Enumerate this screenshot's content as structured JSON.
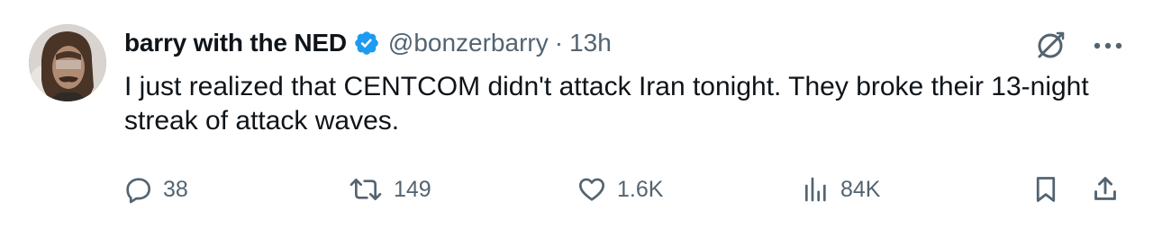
{
  "tweet": {
    "author": {
      "display_name": "barry with the NED",
      "handle": "@bonzerbarry",
      "separator": "·",
      "time": "13h",
      "verified_color": "#1d9bf0"
    },
    "text": "I just realized that CENTCOM didn't attack Iran tonight. They broke their 13-night streak of attack waves.",
    "stats": {
      "replies": "38",
      "reposts": "149",
      "likes": "1.6K",
      "views": "84K"
    },
    "icons": {
      "grok": "grok-icon",
      "more": "more-icon",
      "reply": "reply-icon",
      "repost": "repost-icon",
      "like": "heart-icon",
      "views": "views-icon",
      "bookmark": "bookmark-icon",
      "share": "share-icon"
    },
    "colors": {
      "text": "#0f1419",
      "muted": "#536471",
      "accent": "#1d9bf0"
    }
  }
}
